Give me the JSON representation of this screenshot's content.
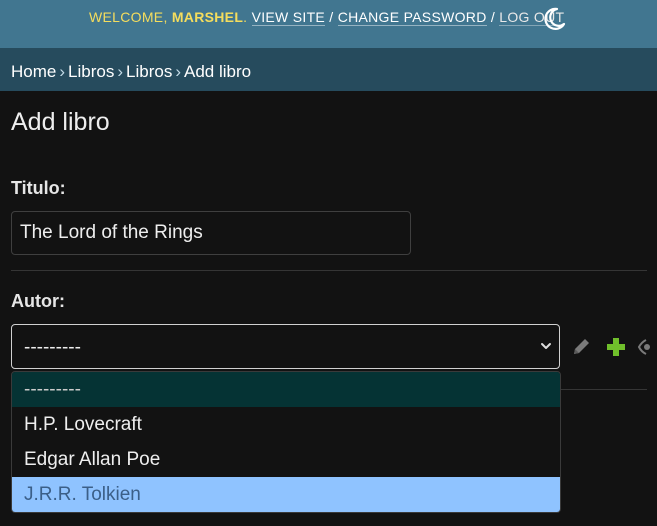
{
  "header": {
    "welcome": "WELCOME,",
    "username": "MARSHEL",
    "view_site": "VIEW SITE",
    "change_password": "CHANGE PASSWORD",
    "log_out": "LOG OUT",
    "separator": "/",
    "theme_icon": "moon-icon"
  },
  "breadcrumbs": {
    "home": "Home",
    "app": "Libros",
    "model": "Libros",
    "current": "Add libro",
    "separator": "›"
  },
  "page": {
    "title": "Add libro"
  },
  "form": {
    "titulo": {
      "label": "Titulo:",
      "value": "The Lord of the Rings"
    },
    "autor": {
      "label": "Autor:",
      "selected": "---------",
      "options": [
        "---------",
        "H.P. Lovecraft",
        "Edgar Allan Poe",
        "J.R.R. Tolkien"
      ],
      "highlighted_option": "J.R.R. Tolkien",
      "actions": [
        "pencil-icon",
        "plus-icon",
        "view-icon"
      ]
    }
  },
  "colors": {
    "header_bg": "#417690",
    "breadcrumbs_bg": "#264b5d",
    "body_bg": "#121212",
    "welcome_text": "#f5dd5d",
    "add_icon": "#70bf2b",
    "highlight_option": "#8fc3ff"
  }
}
